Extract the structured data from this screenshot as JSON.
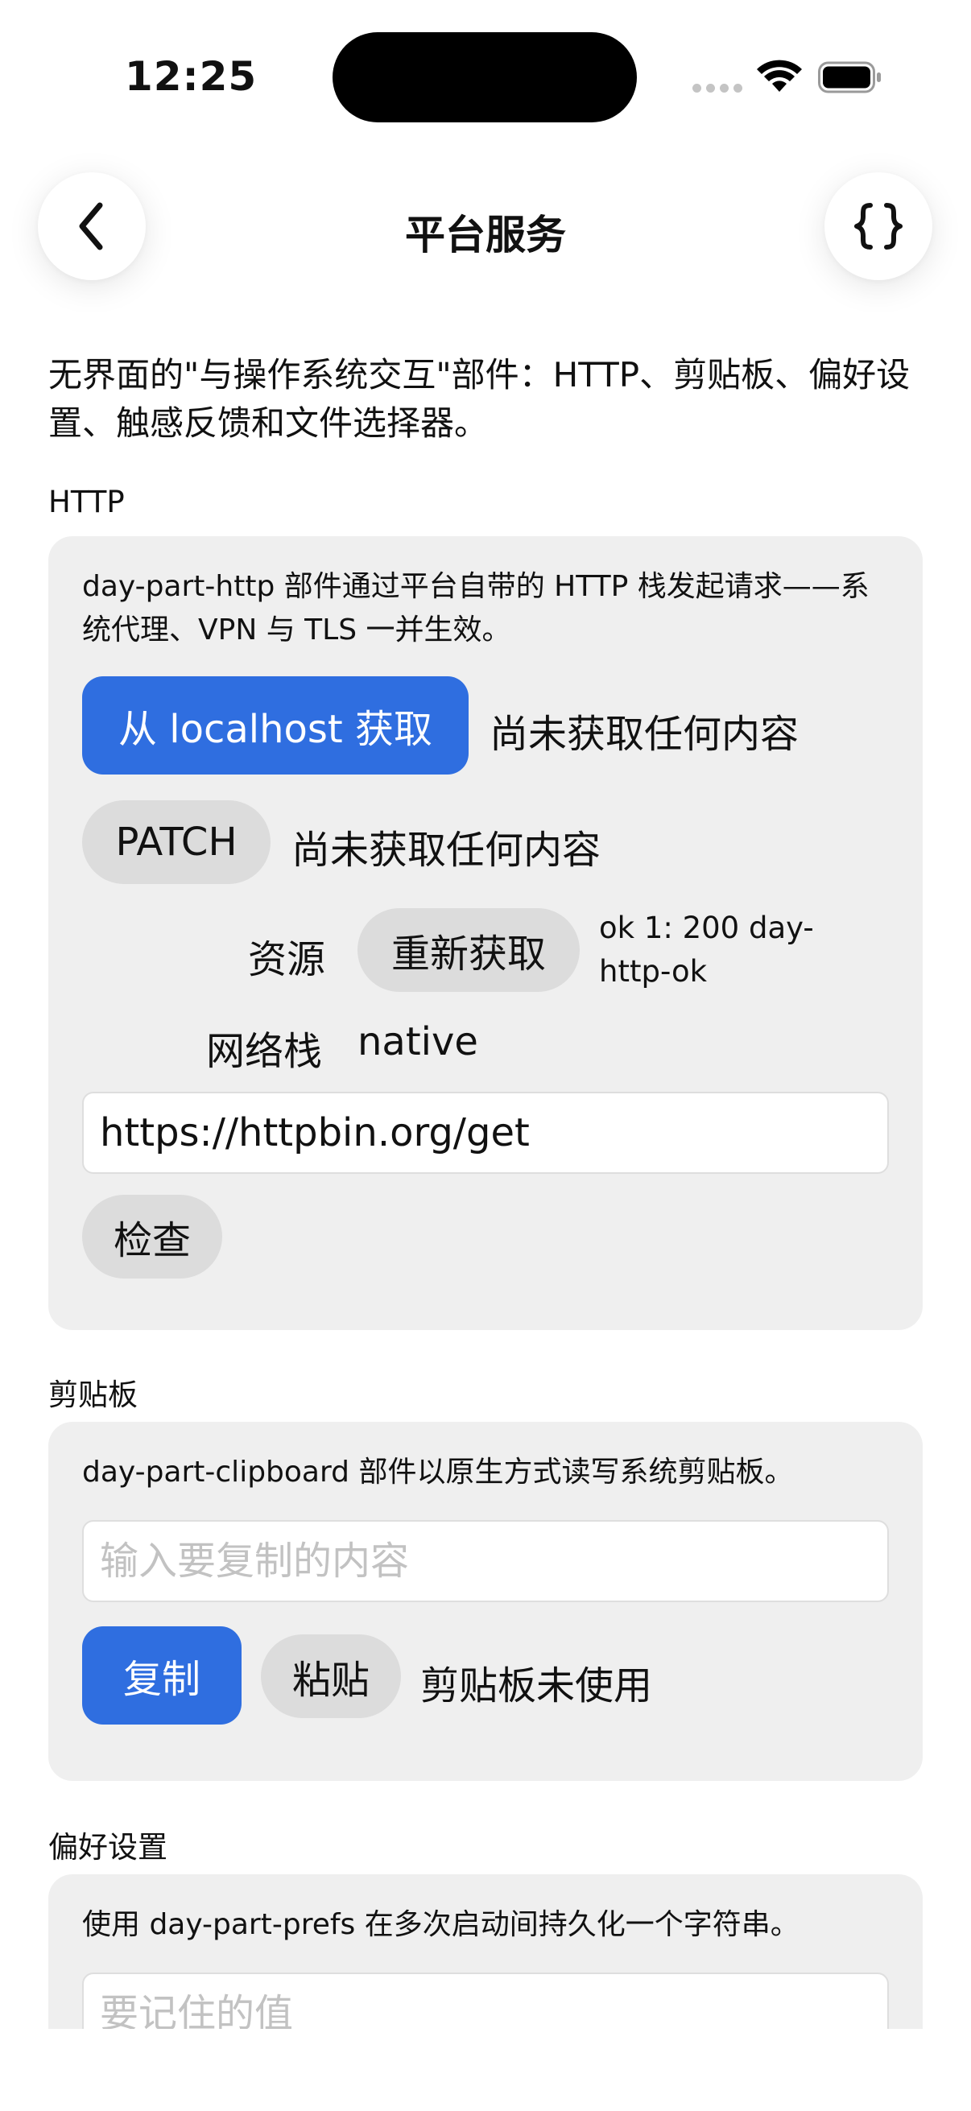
{
  "status": {
    "time": "12:25"
  },
  "nav": {
    "title": "平台服务"
  },
  "intro": "无界面的\"与操作系统交互\"部件：HTTP、剪贴板、偏好设置、触感反馈和文件选择器。",
  "http": {
    "heading": "HTTP",
    "desc": "day-part-http 部件通过平台自带的 HTTP 栈发起请求——系统代理、VPN 与 TLS 一并生效。",
    "fetch_button": "从 localhost 获取",
    "fetch_status": "尚未获取任何内容",
    "patch_button": "PATCH",
    "patch_status": "尚未获取任何内容",
    "resource_label": "资源",
    "refetch_button": "重新获取",
    "resource_result": "ok 1: 200 day-http-ok",
    "stack_label": "网络栈",
    "stack_value": "native",
    "url_value": "https://httpbin.org/get",
    "inspect_button": "检查"
  },
  "clipboard": {
    "heading": "剪贴板",
    "desc": "day-part-clipboard 部件以原生方式读写系统剪贴板。",
    "input_placeholder": "输入要复制的内容",
    "copy_button": "复制",
    "paste_button": "粘贴",
    "status": "剪贴板未使用"
  },
  "prefs": {
    "heading": "偏好设置",
    "desc": "使用 day-part-prefs 在多次启动间持久化一个字符串。",
    "input_placeholder": "要记住的值"
  },
  "colors": {
    "accent": "#2f6ee0",
    "card_bg": "#efefef",
    "secondary_button": "#dcdcdc"
  },
  "icons": [
    "chevron-left-icon",
    "braces-icon",
    "wifi-icon",
    "battery-icon",
    "cellular-signal-icon"
  ]
}
